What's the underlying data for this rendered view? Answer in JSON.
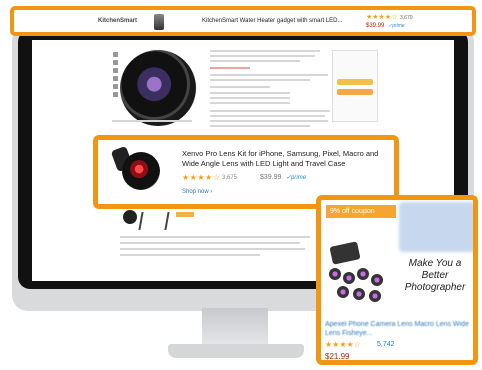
{
  "banner": {
    "brand": "KitchenSmart",
    "title": "KitchenSmart Water Heater gadget with smart LED...",
    "stars": "★★★★☆",
    "reviews": "3,670",
    "price": "$39.99",
    "prime": "✓prime"
  },
  "card": {
    "title": "Xenvo Pro Lens Kit for iPhone, Samsung, Pixel, Macro and Wide Angle Lens with LED Light and Travel Case",
    "stars": "★★★★☆",
    "reviews": "3,675",
    "price": "$39.99",
    "prime": "✓prime",
    "shop_label": "Shop now ›"
  },
  "sidead": {
    "badge": "9% off coupon",
    "tagline": "Make You a Better Photographer",
    "title": "Apexel Phone Camera Lens Macro Lens Wide Lens Fisheye...",
    "stars": "★★★★☆",
    "reviews": "5,742",
    "price": "$21.99"
  },
  "colors": {
    "highlight": "#f29512",
    "star": "#f6a01a",
    "link": "#2a7ab8",
    "price": "#b12704"
  }
}
